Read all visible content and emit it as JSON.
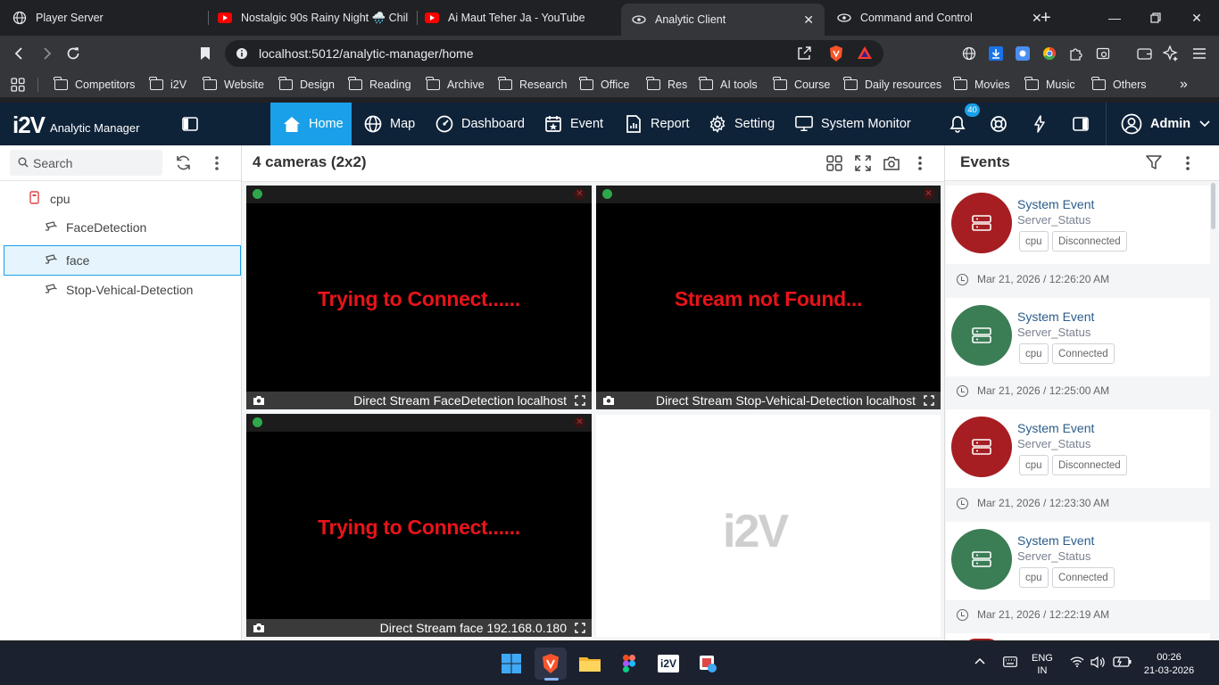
{
  "browser": {
    "tabs": [
      {
        "title": "Player Server",
        "icon": "globe-icon"
      },
      {
        "title": "Nostalgic 90s Rainy Night 🌧️ Chill",
        "icon": "youtube-icon"
      },
      {
        "title": "Ai Maut Teher Ja - YouTube",
        "icon": "youtube-icon"
      },
      {
        "title": "Analytic Client",
        "icon": "app-icon"
      },
      {
        "title": "Command and Control",
        "icon": "app-icon"
      }
    ],
    "new_tab": "+",
    "url_host": "localhost",
    "url_path": ":5012/analytic-manager/home",
    "bookmarks": [
      "Competitors",
      "i2V",
      "Website",
      "Design",
      "Reading",
      "Archive",
      "Research",
      "Office",
      "Res",
      "AI tools",
      "Course",
      "Daily resources",
      "Movies",
      "Music",
      "Others"
    ]
  },
  "app": {
    "logo": "i2V",
    "name": "Analytic Manager",
    "nav": [
      {
        "label": "Home",
        "icon": "home-icon"
      },
      {
        "label": "Map",
        "icon": "globe-icon"
      },
      {
        "label": "Dashboard",
        "icon": "gauge-icon"
      },
      {
        "label": "Event",
        "icon": "calendar-star-icon"
      },
      {
        "label": "Report",
        "icon": "report-icon"
      },
      {
        "label": "Setting",
        "icon": "gear-icon"
      },
      {
        "label": "System Monitor",
        "icon": "monitor-icon"
      }
    ],
    "notification_count": "40",
    "user": "Admin",
    "accent": "#1aa0e8",
    "header_bg": "#0e2238"
  },
  "left": {
    "search_placeholder": "Search",
    "tree": {
      "server": "cpu",
      "items": [
        "FaceDetection",
        "face",
        "Stop-Vehical-Detection"
      ]
    }
  },
  "center": {
    "title": "4 cameras (2x2)",
    "cameras": [
      {
        "message": "Trying to Connect......",
        "caption": "Direct Stream  FaceDetection localhost"
      },
      {
        "message": "Stream not Found...",
        "caption": "Direct Stream  Stop-Vehical-Detection localhost"
      },
      {
        "message": "Trying to Connect......",
        "caption": "Direct Stream  face 192.168.0.180"
      }
    ],
    "watermark": "i2V"
  },
  "events": {
    "title": "Events",
    "items": [
      {
        "title": "System Event",
        "subtitle": "Server_Status",
        "tag": "cpu",
        "status": "Disconnected",
        "time": "Mar 21, 2026 / 12:26:20 AM",
        "color": "#a61e22"
      },
      {
        "title": "System Event",
        "subtitle": "Server_Status",
        "tag": "cpu",
        "status": "Connected",
        "time": "Mar 21, 2026 / 12:25:00 AM",
        "color": "#3b7d55"
      },
      {
        "title": "System Event",
        "subtitle": "Server_Status",
        "tag": "cpu",
        "status": "Disconnected",
        "time": "Mar 21, 2026 / 12:23:30 AM",
        "color": "#a61e22"
      },
      {
        "title": "System Event",
        "subtitle": "Server_Status",
        "tag": "cpu",
        "status": "Connected",
        "time": "Mar 21, 2026 / 12:22:19 AM",
        "color": "#3b7d55"
      }
    ]
  },
  "taskbar": {
    "lang_top": "ENG",
    "lang_bottom": "IN",
    "time": "00:26",
    "date": "21-03-2026",
    "app_label": "i2V"
  }
}
